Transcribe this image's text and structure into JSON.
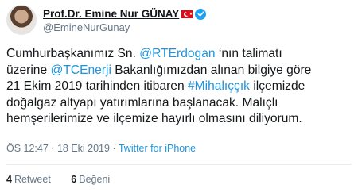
{
  "user": {
    "display_name": "Prof.Dr. Emine Nur GÜNAY",
    "handle": "@EmineNurGunay"
  },
  "tweet": {
    "lines": [
      [
        {
          "t": "Cumhurbaşkanımız Sn. ",
          "link": false
        },
        {
          "t": "@RTErdogan",
          "link": true
        },
        {
          "t": " ‘nın talimatı",
          "link": false
        }
      ],
      [
        {
          "t": "üzerine ",
          "link": false
        },
        {
          "t": "@TCEnerji",
          "link": true
        },
        {
          "t": " Bakanlığımızdan alınan bilgiye göre",
          "link": false
        }
      ],
      [
        {
          "t": "21 Ekim 2019 tarihinden itibaren ",
          "link": false
        },
        {
          "t": "#Mihalıççık",
          "link": true
        },
        {
          "t": " ilçemizde",
          "link": false
        }
      ],
      [
        {
          "t": "doğalgaz altyapı yatırımlarına başlanacak. Malıçlı",
          "link": false
        }
      ],
      [
        {
          "t": "hemşerilerimize ve ilçemize hayırlı olmasını diliyorum.",
          "link": false
        }
      ]
    ]
  },
  "meta": {
    "time": "ÖS 12:47",
    "separator": " · ",
    "date": "18 Eki 2019",
    "source": "Twitter for iPhone"
  },
  "stats": {
    "retweets_count": "4",
    "retweets_label": "Retweet",
    "likes_count": "6",
    "likes_label": "Beğeni"
  },
  "colors": {
    "link": "#1b95e0",
    "verified": "#1da1f2",
    "flag": "#e30a17"
  },
  "icons": [
    "turkey-flag-icon",
    "verified-badge-icon"
  ]
}
